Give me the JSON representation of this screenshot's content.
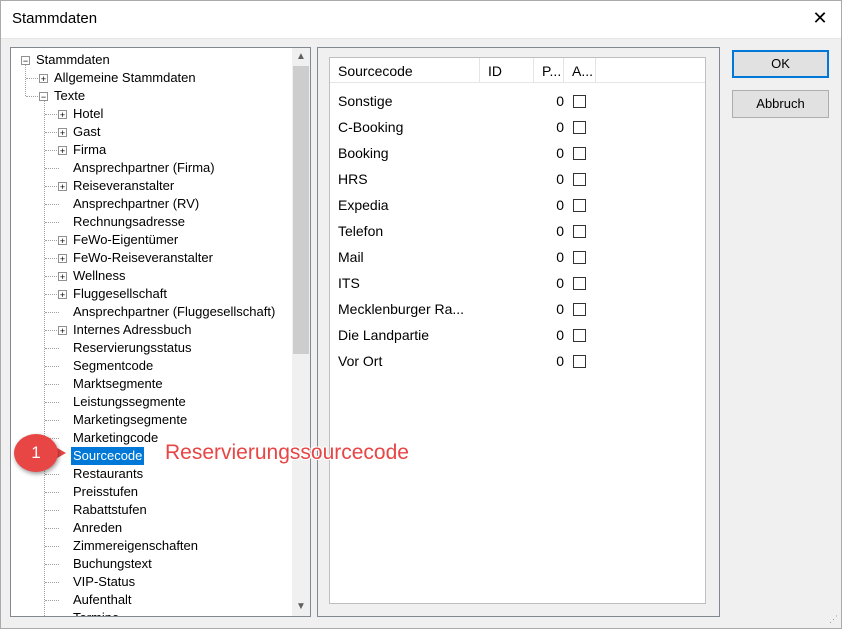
{
  "window": {
    "title": "Stammdaten",
    "close_glyph": "✕"
  },
  "tree": {
    "items": [
      {
        "label": "Stammdaten",
        "level": 0,
        "expander": "−"
      },
      {
        "label": "Allgemeine Stammdaten",
        "level": 1,
        "expander": "+"
      },
      {
        "label": "Texte",
        "level": 1,
        "expander": "−"
      },
      {
        "label": "Hotel",
        "level": 2,
        "expander": "+"
      },
      {
        "label": "Gast",
        "level": 2,
        "expander": "+"
      },
      {
        "label": "Firma",
        "level": 2,
        "expander": "+"
      },
      {
        "label": "Ansprechpartner (Firma)",
        "level": 2,
        "expander": ""
      },
      {
        "label": "Reiseveranstalter",
        "level": 2,
        "expander": "+"
      },
      {
        "label": "Ansprechpartner (RV)",
        "level": 2,
        "expander": ""
      },
      {
        "label": "Rechnungsadresse",
        "level": 2,
        "expander": ""
      },
      {
        "label": "FeWo-Eigentümer",
        "level": 2,
        "expander": "+"
      },
      {
        "label": "FeWo-Reiseveranstalter",
        "level": 2,
        "expander": "+"
      },
      {
        "label": "Wellness",
        "level": 2,
        "expander": "+"
      },
      {
        "label": "Fluggesellschaft",
        "level": 2,
        "expander": "+"
      },
      {
        "label": "Ansprechpartner (Fluggesellschaft)",
        "level": 2,
        "expander": ""
      },
      {
        "label": "Internes Adressbuch",
        "level": 2,
        "expander": "+"
      },
      {
        "label": "Reservierungsstatus",
        "level": 2,
        "expander": ""
      },
      {
        "label": "Segmentcode",
        "level": 2,
        "expander": ""
      },
      {
        "label": "Marktsegmente",
        "level": 2,
        "expander": ""
      },
      {
        "label": "Leistungssegmente",
        "level": 2,
        "expander": ""
      },
      {
        "label": "Marketingsegmente",
        "level": 2,
        "expander": ""
      },
      {
        "label": "Marketingcode",
        "level": 2,
        "expander": ""
      },
      {
        "label": "Sourcecode",
        "level": 2,
        "expander": "",
        "selected": true
      },
      {
        "label": "Restaurants",
        "level": 2,
        "expander": ""
      },
      {
        "label": "Preisstufen",
        "level": 2,
        "expander": ""
      },
      {
        "label": "Rabattstufen",
        "level": 2,
        "expander": ""
      },
      {
        "label": "Anreden",
        "level": 2,
        "expander": ""
      },
      {
        "label": "Zimmereigenschaften",
        "level": 2,
        "expander": ""
      },
      {
        "label": "Buchungstext",
        "level": 2,
        "expander": ""
      },
      {
        "label": "VIP-Status",
        "level": 2,
        "expander": ""
      },
      {
        "label": "Aufenthalt",
        "level": 2,
        "expander": ""
      },
      {
        "label": "Termine",
        "level": 2,
        "expander": ""
      }
    ],
    "scroll_up": "▲",
    "scroll_down": "▼"
  },
  "grid": {
    "columns": [
      "Sourcecode",
      "ID",
      "P...",
      "A..."
    ],
    "rows": [
      {
        "name": "Sonstige",
        "p": "0",
        "checked": false
      },
      {
        "name": "C-Booking",
        "p": "0",
        "checked": false
      },
      {
        "name": "Booking",
        "p": "0",
        "checked": false
      },
      {
        "name": "HRS",
        "p": "0",
        "checked": false
      },
      {
        "name": "Expedia",
        "p": "0",
        "checked": false
      },
      {
        "name": "Telefon",
        "p": "0",
        "checked": false
      },
      {
        "name": "Mail",
        "p": "0",
        "checked": false
      },
      {
        "name": "ITS",
        "p": "0",
        "checked": false
      },
      {
        "name": "Mecklenburger Ra...",
        "p": "0",
        "checked": false
      },
      {
        "name": "Die Landpartie",
        "p": "0",
        "checked": false
      },
      {
        "name": "Vor Ort",
        "p": "0",
        "checked": false
      }
    ]
  },
  "buttons": {
    "ok": "OK",
    "cancel": "Abbruch"
  },
  "callout": {
    "number": "1",
    "text": "Reservierungssourcecode",
    "color": "#e84545"
  }
}
